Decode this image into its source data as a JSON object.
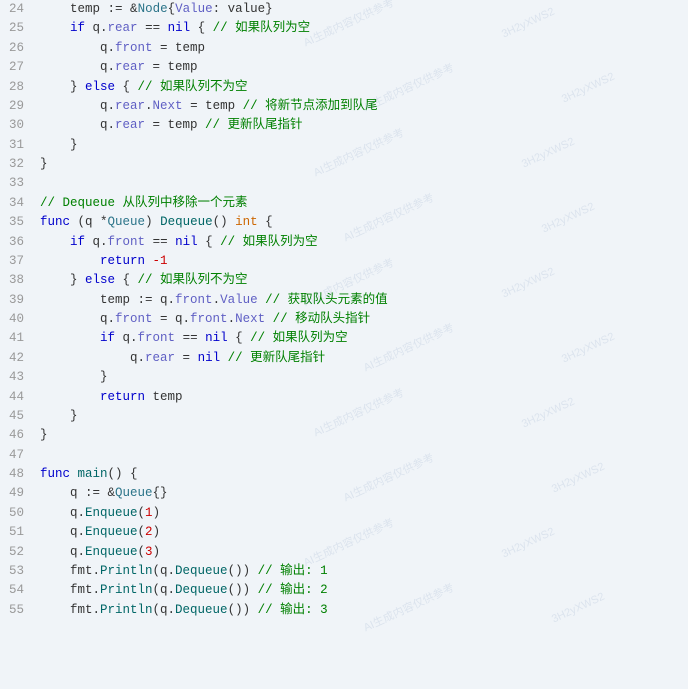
{
  "editor": {
    "background": "#f0f4f8",
    "lines": [
      {
        "num": 24,
        "tokens": [
          {
            "t": "    ",
            "c": "var"
          },
          {
            "t": "temp",
            "c": "var"
          },
          {
            "t": " := ",
            "c": "op"
          },
          {
            "t": "&",
            "c": "op"
          },
          {
            "t": "Node",
            "c": "type-name"
          },
          {
            "t": "{",
            "c": "punct"
          },
          {
            "t": "Value",
            "c": "field"
          },
          {
            "t": ": value}",
            "c": "punct"
          }
        ]
      },
      {
        "num": 25,
        "tokens": [
          {
            "t": "    ",
            "c": "var"
          },
          {
            "t": "if",
            "c": "kw"
          },
          {
            "t": " q.",
            "c": "var"
          },
          {
            "t": "rear",
            "c": "field"
          },
          {
            "t": " == ",
            "c": "op"
          },
          {
            "t": "nil",
            "c": "kw"
          },
          {
            "t": " { ",
            "c": "punct"
          },
          {
            "t": "// 如果队列为空",
            "c": "comment"
          }
        ]
      },
      {
        "num": 26,
        "tokens": [
          {
            "t": "        q.",
            "c": "var"
          },
          {
            "t": "front",
            "c": "field"
          },
          {
            "t": " = temp",
            "c": "var"
          }
        ]
      },
      {
        "num": 27,
        "tokens": [
          {
            "t": "        q.",
            "c": "var"
          },
          {
            "t": "rear",
            "c": "field"
          },
          {
            "t": " = temp",
            "c": "var"
          }
        ]
      },
      {
        "num": 28,
        "tokens": [
          {
            "t": "    } ",
            "c": "punct"
          },
          {
            "t": "else",
            "c": "kw"
          },
          {
            "t": " { ",
            "c": "punct"
          },
          {
            "t": "// 如果队列不为空",
            "c": "comment"
          }
        ]
      },
      {
        "num": 29,
        "tokens": [
          {
            "t": "        q.",
            "c": "var"
          },
          {
            "t": "rear",
            "c": "field"
          },
          {
            "t": ".",
            "c": "punct"
          },
          {
            "t": "Next",
            "c": "field"
          },
          {
            "t": " = temp ",
            "c": "var"
          },
          {
            "t": "// 将新节点添加到队尾",
            "c": "comment"
          }
        ]
      },
      {
        "num": 30,
        "tokens": [
          {
            "t": "        q.",
            "c": "var"
          },
          {
            "t": "rear",
            "c": "field"
          },
          {
            "t": " = temp ",
            "c": "var"
          },
          {
            "t": "// 更新队尾指针",
            "c": "comment"
          }
        ]
      },
      {
        "num": 31,
        "tokens": [
          {
            "t": "    }",
            "c": "punct"
          }
        ]
      },
      {
        "num": 32,
        "tokens": [
          {
            "t": "}",
            "c": "punct"
          }
        ]
      },
      {
        "num": 33,
        "tokens": []
      },
      {
        "num": 34,
        "tokens": [
          {
            "t": "// Dequeue 从队列中移除一个元素",
            "c": "comment"
          }
        ]
      },
      {
        "num": 35,
        "tokens": [
          {
            "t": "func",
            "c": "kw"
          },
          {
            "t": " (q ",
            "c": "var"
          },
          {
            "t": "*",
            "c": "op"
          },
          {
            "t": "Queue",
            "c": "type-name"
          },
          {
            "t": ") ",
            "c": "punct"
          },
          {
            "t": "Dequeue",
            "c": "fn"
          },
          {
            "t": "() ",
            "c": "punct"
          },
          {
            "t": "int",
            "c": "kw-type"
          },
          {
            "t": " {",
            "c": "punct"
          }
        ]
      },
      {
        "num": 36,
        "tokens": [
          {
            "t": "    ",
            "c": "var"
          },
          {
            "t": "if",
            "c": "kw"
          },
          {
            "t": " q.",
            "c": "var"
          },
          {
            "t": "front",
            "c": "field"
          },
          {
            "t": " == ",
            "c": "op"
          },
          {
            "t": "nil",
            "c": "kw"
          },
          {
            "t": " { ",
            "c": "punct"
          },
          {
            "t": "// 如果队列为空",
            "c": "comment"
          }
        ]
      },
      {
        "num": 37,
        "tokens": [
          {
            "t": "        ",
            "c": "var"
          },
          {
            "t": "return",
            "c": "kw"
          },
          {
            "t": " ",
            "c": "var"
          },
          {
            "t": "-1",
            "c": "num"
          }
        ]
      },
      {
        "num": 38,
        "tokens": [
          {
            "t": "    } ",
            "c": "punct"
          },
          {
            "t": "else",
            "c": "kw"
          },
          {
            "t": " { ",
            "c": "punct"
          },
          {
            "t": "// 如果队列不为空",
            "c": "comment"
          }
        ]
      },
      {
        "num": 39,
        "tokens": [
          {
            "t": "        ",
            "c": "var"
          },
          {
            "t": "temp",
            "c": "var"
          },
          {
            "t": " := q.",
            "c": "var"
          },
          {
            "t": "front",
            "c": "field"
          },
          {
            "t": ".",
            "c": "punct"
          },
          {
            "t": "Value",
            "c": "field"
          },
          {
            "t": " ",
            "c": "var"
          },
          {
            "t": "// 获取队头元素的值",
            "c": "comment"
          }
        ]
      },
      {
        "num": 40,
        "tokens": [
          {
            "t": "        q.",
            "c": "var"
          },
          {
            "t": "front",
            "c": "field"
          },
          {
            "t": " = q.",
            "c": "var"
          },
          {
            "t": "front",
            "c": "field"
          },
          {
            "t": ".",
            "c": "punct"
          },
          {
            "t": "Next",
            "c": "field"
          },
          {
            "t": " ",
            "c": "var"
          },
          {
            "t": "// 移动队头指针",
            "c": "comment"
          }
        ]
      },
      {
        "num": 41,
        "tokens": [
          {
            "t": "        ",
            "c": "var"
          },
          {
            "t": "if",
            "c": "kw"
          },
          {
            "t": " q.",
            "c": "var"
          },
          {
            "t": "front",
            "c": "field"
          },
          {
            "t": " == ",
            "c": "op"
          },
          {
            "t": "nil",
            "c": "kw"
          },
          {
            "t": " { ",
            "c": "punct"
          },
          {
            "t": "// 如果队列为空",
            "c": "comment"
          }
        ]
      },
      {
        "num": 42,
        "tokens": [
          {
            "t": "            q.",
            "c": "var"
          },
          {
            "t": "rear",
            "c": "field"
          },
          {
            "t": " = ",
            "c": "op"
          },
          {
            "t": "nil",
            "c": "kw"
          },
          {
            "t": " ",
            "c": "var"
          },
          {
            "t": "// 更新队尾指针",
            "c": "comment"
          }
        ]
      },
      {
        "num": 43,
        "tokens": [
          {
            "t": "        }",
            "c": "punct"
          }
        ]
      },
      {
        "num": 44,
        "tokens": [
          {
            "t": "        ",
            "c": "var"
          },
          {
            "t": "return",
            "c": "kw"
          },
          {
            "t": " temp",
            "c": "var"
          }
        ]
      },
      {
        "num": 45,
        "tokens": [
          {
            "t": "    }",
            "c": "punct"
          }
        ]
      },
      {
        "num": 46,
        "tokens": [
          {
            "t": "}",
            "c": "punct"
          }
        ]
      },
      {
        "num": 47,
        "tokens": []
      },
      {
        "num": 48,
        "tokens": [
          {
            "t": "func",
            "c": "kw"
          },
          {
            "t": " ",
            "c": "var"
          },
          {
            "t": "main",
            "c": "fn"
          },
          {
            "t": "() {",
            "c": "punct"
          }
        ]
      },
      {
        "num": 49,
        "tokens": [
          {
            "t": "    q := &",
            "c": "var"
          },
          {
            "t": "Queue",
            "c": "type-name"
          },
          {
            "t": "{}",
            "c": "punct"
          }
        ]
      },
      {
        "num": 50,
        "tokens": [
          {
            "t": "    q.",
            "c": "var"
          },
          {
            "t": "Enqueue",
            "c": "fn"
          },
          {
            "t": "(",
            "c": "punct"
          },
          {
            "t": "1",
            "c": "num"
          },
          {
            "t": ")",
            "c": "punct"
          }
        ]
      },
      {
        "num": 51,
        "tokens": [
          {
            "t": "    q.",
            "c": "var"
          },
          {
            "t": "Enqueue",
            "c": "fn"
          },
          {
            "t": "(",
            "c": "punct"
          },
          {
            "t": "2",
            "c": "num"
          },
          {
            "t": ")",
            "c": "punct"
          }
        ]
      },
      {
        "num": 52,
        "tokens": [
          {
            "t": "    q.",
            "c": "var"
          },
          {
            "t": "Enqueue",
            "c": "fn"
          },
          {
            "t": "(",
            "c": "punct"
          },
          {
            "t": "3",
            "c": "num"
          },
          {
            "t": ")",
            "c": "punct"
          }
        ]
      },
      {
        "num": 53,
        "tokens": [
          {
            "t": "    fmt.",
            "c": "var"
          },
          {
            "t": "Println",
            "c": "fn"
          },
          {
            "t": "(q.",
            "c": "var"
          },
          {
            "t": "Dequeue",
            "c": "fn"
          },
          {
            "t": "()) ",
            "c": "punct"
          },
          {
            "t": "// 输出: 1",
            "c": "comment"
          }
        ]
      },
      {
        "num": 54,
        "tokens": [
          {
            "t": "    fmt.",
            "c": "var"
          },
          {
            "t": "Println",
            "c": "fn"
          },
          {
            "t": "(q.",
            "c": "var"
          },
          {
            "t": "Dequeue",
            "c": "fn"
          },
          {
            "t": "()) ",
            "c": "punct"
          },
          {
            "t": "// 输出: 2",
            "c": "comment"
          }
        ]
      },
      {
        "num": 55,
        "tokens": [
          {
            "t": "    fmt.",
            "c": "var"
          },
          {
            "t": "Println",
            "c": "fn"
          },
          {
            "t": "(q.",
            "c": "var"
          },
          {
            "t": "Dequeue",
            "c": "fn"
          },
          {
            "t": "()) ",
            "c": "punct"
          },
          {
            "t": "// 输出: 3",
            "c": "comment"
          }
        ]
      }
    ]
  }
}
